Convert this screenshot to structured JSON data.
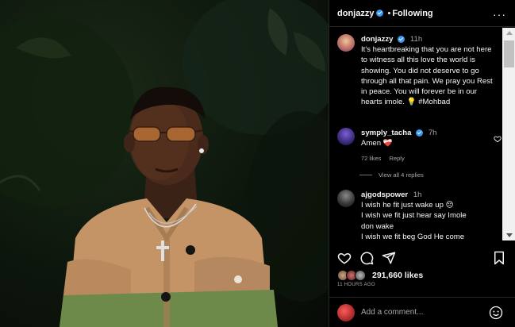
{
  "header": {
    "username": "donjazzy",
    "separator": "•",
    "follow_state": "Following",
    "more": "···"
  },
  "caption": {
    "username": "donjazzy",
    "time": "11h",
    "text": "It's heartbreaking that you are not here to witness all this love the world is showing. You did not deserve to go through all that pain. We pray you Rest in peace. You will forever be in our hearts imole. 💡 #Mohbad"
  },
  "comments": [
    {
      "username": "symply_tacha",
      "time": "7h",
      "text": "Amen ❤️‍🩹",
      "likes": "72 likes",
      "reply": "Reply"
    },
    {
      "username": "ajgodspower",
      "time": "1h",
      "text_lines": [
        "I wish he fit just wake up 😔",
        "I wish we fit just hear say Imole",
        "don wake",
        "I wish we fit beg God He come"
      ]
    }
  ],
  "view_replies": "View all 4 replies",
  "likes": {
    "count": "291,660 likes"
  },
  "posted_ago": "11 HOURS AGO",
  "add_comment": {
    "placeholder": "Add a comment..."
  },
  "icons": [
    "heart-icon",
    "comment-icon",
    "share-icon",
    "bookmark-icon",
    "emoji-icon",
    "verified-icon"
  ],
  "colors": {
    "verified": "#3897f0",
    "panel_bg": "#000000",
    "muted_text": "#a8a8a8"
  }
}
